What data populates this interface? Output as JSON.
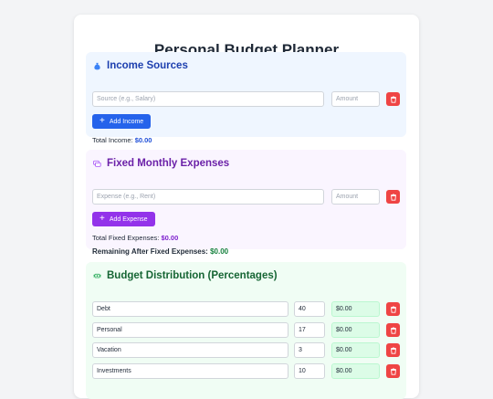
{
  "page_title": "Personal Budget Planner",
  "income": {
    "title": "Income Sources",
    "icon": "money-bag-icon",
    "source_placeholder": "Source (e.g., Salary)",
    "amount_placeholder": "Amount",
    "add_label": "Add Income",
    "total_label": "Total Income:",
    "total_value": "$0.00"
  },
  "fixed": {
    "title": "Fixed Monthly Expenses",
    "icon": "credit-cards-icon",
    "expense_placeholder": "Expense (e.g., Rent)",
    "amount_placeholder": "Amount",
    "add_label": "Add Expense",
    "total_label": "Total Fixed Expenses:",
    "total_value": "$0.00",
    "remaining_label": "Remaining After Fixed Expenses:",
    "remaining_value": "$0.00"
  },
  "distribution": {
    "title": "Budget Distribution (Percentages)",
    "icon": "money-wings-icon",
    "rows": [
      {
        "name": "Debt",
        "percent": "40",
        "amount": "$0.00"
      },
      {
        "name": "Personal",
        "percent": "17",
        "amount": "$0.00"
      },
      {
        "name": "Vacation",
        "percent": "3",
        "amount": "$0.00"
      },
      {
        "name": "Investments",
        "percent": "10",
        "amount": "$0.00"
      }
    ]
  },
  "colors": {
    "income_accent": "#2563eb",
    "expense_accent": "#9333ea",
    "distribution_accent": "#16a34a",
    "delete": "#ef4444"
  }
}
